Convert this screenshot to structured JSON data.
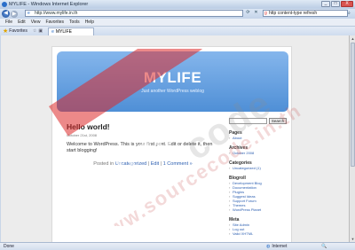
{
  "window": {
    "title": "MYLIFE - Windows Internet Explorer",
    "minimize": "_",
    "maximize": "□",
    "close": "X"
  },
  "address_bar": {
    "url": "http://www.mylife.in.th"
  },
  "search_bar": {
    "value": "http content-type refresh"
  },
  "menu": [
    "File",
    "Edit",
    "View",
    "Favorites",
    "Tools",
    "Help"
  ],
  "favorites": {
    "label": "Favorites"
  },
  "tab": {
    "label": "MYLIFE"
  },
  "blog": {
    "title": "MYLIFE",
    "description": "Just another WordPress weblog"
  },
  "post": {
    "title": "Hello world!",
    "date": "October 21st, 2008",
    "body": "Welcome to WordPress. This is your first post. Edit or delete it, then start blogging!",
    "posted_in": "Posted in",
    "category": "Uncategorized",
    "sep1": "|",
    "edit": "Edit",
    "sep2": "|",
    "comments": "1 Comment »"
  },
  "sidebar": {
    "search_button": "Search",
    "pages_title": "Pages",
    "pages": [
      "About"
    ],
    "archives_title": "Archives",
    "archives": [
      "October 2008"
    ],
    "categories_title": "Categories",
    "categories": [
      "Uncategorized (1)"
    ],
    "blogroll_title": "Blogroll",
    "blogroll": [
      "Development Blog",
      "Documentation",
      "Plugins",
      "Suggest Ideas",
      "Support Forum",
      "Themes",
      "WordPress Planet"
    ],
    "meta_title": "Meta",
    "meta": [
      "Site Admin",
      "Log out",
      "Valid XHTML"
    ]
  },
  "status": {
    "text": "Done",
    "zone": "Internet"
  },
  "watermark": {
    "text1": "Source",
    "text2": "code",
    "text3": "www.sourcecode.in.th"
  },
  "colors": {
    "header_top": "#85b6ec",
    "header_bottom": "#4f8fd6",
    "link": "#2a5db0",
    "watermark": "#dc2828"
  }
}
